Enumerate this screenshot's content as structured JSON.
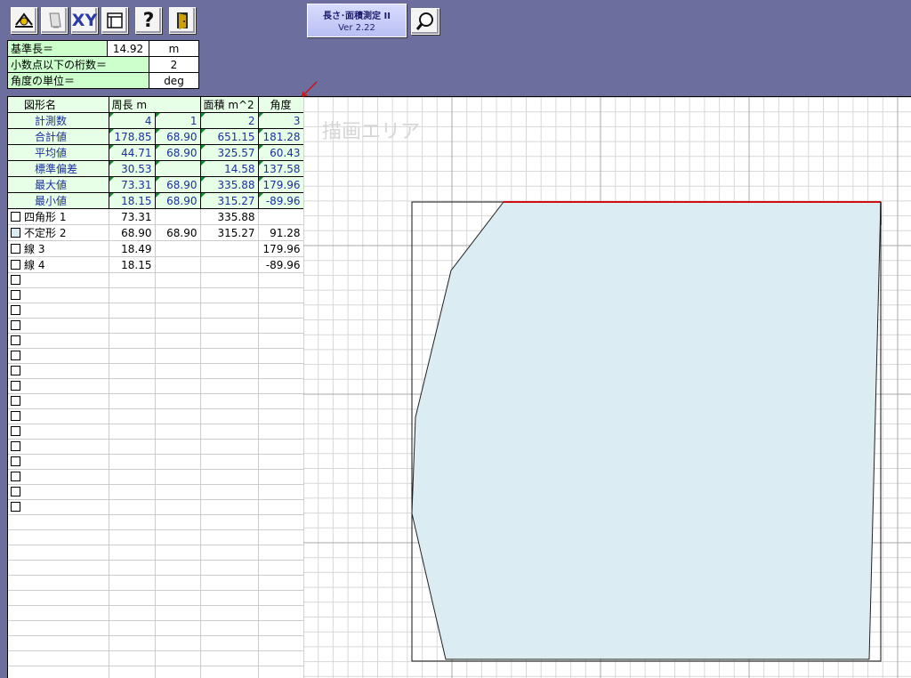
{
  "toolbar": {
    "buttons": [
      {
        "name": "measure-tool-button",
        "icon": "measure-icon"
      },
      {
        "name": "eraser-button",
        "icon": "eraser-icon"
      },
      {
        "name": "xy-button",
        "icon": "xy-icon",
        "label": "XY"
      },
      {
        "name": "window-button",
        "icon": "window-icon"
      },
      {
        "name": "help-button",
        "icon": "question-icon",
        "label": "?"
      },
      {
        "name": "exit-button",
        "icon": "door-icon"
      }
    ],
    "zoom_icon": "magnifier-icon"
  },
  "app": {
    "title": "長さ･面積測定 II",
    "version": "Ver 2.22"
  },
  "settings": [
    {
      "label": "基準長＝",
      "value": "14.92",
      "unit": "m"
    },
    {
      "label": "小数点以下の桁数＝",
      "value": "2"
    },
    {
      "label": "角度の単位＝",
      "value": "deg"
    }
  ],
  "table": {
    "headers": [
      "図形名",
      "周長 m",
      "",
      "面積 m^2",
      "角度"
    ],
    "stats": [
      {
        "name": "計測数",
        "vals": [
          "4",
          "1",
          "2",
          "3"
        ]
      },
      {
        "name": "合計値",
        "vals": [
          "178.85",
          "68.90",
          "651.15",
          "181.28"
        ]
      },
      {
        "name": "平均値",
        "vals": [
          "44.71",
          "68.90",
          "325.57",
          "60.43"
        ]
      },
      {
        "name": "標準偏差",
        "vals": [
          "30.53",
          "",
          "14.58",
          "137.58"
        ]
      },
      {
        "name": "最大値",
        "vals": [
          "73.31",
          "68.90",
          "335.88",
          "179.96"
        ]
      },
      {
        "name": "最小値",
        "vals": [
          "18.15",
          "68.90",
          "315.27",
          "-89.96"
        ]
      }
    ],
    "rows": [
      {
        "name": "四角形 1",
        "c1": "73.31",
        "c2": "",
        "c3": "335.88",
        "c4": "",
        "cyan": false
      },
      {
        "name": "不定形 2",
        "c1": "68.90",
        "c2": "68.90",
        "c3": "315.27",
        "c4": "91.28",
        "cyan": true
      },
      {
        "name": "線 3",
        "c1": "18.49",
        "c2": "",
        "c3": "",
        "c4": "179.96",
        "cyan": false
      },
      {
        "name": "線 4",
        "c1": "18.15",
        "c2": "",
        "c3": "",
        "c4": "-89.96",
        "cyan": false
      }
    ],
    "empty_rows": 16
  },
  "draw_area": {
    "label": "描画エリア",
    "fill_color": "#dbecf2",
    "line_color": "#d01010"
  }
}
